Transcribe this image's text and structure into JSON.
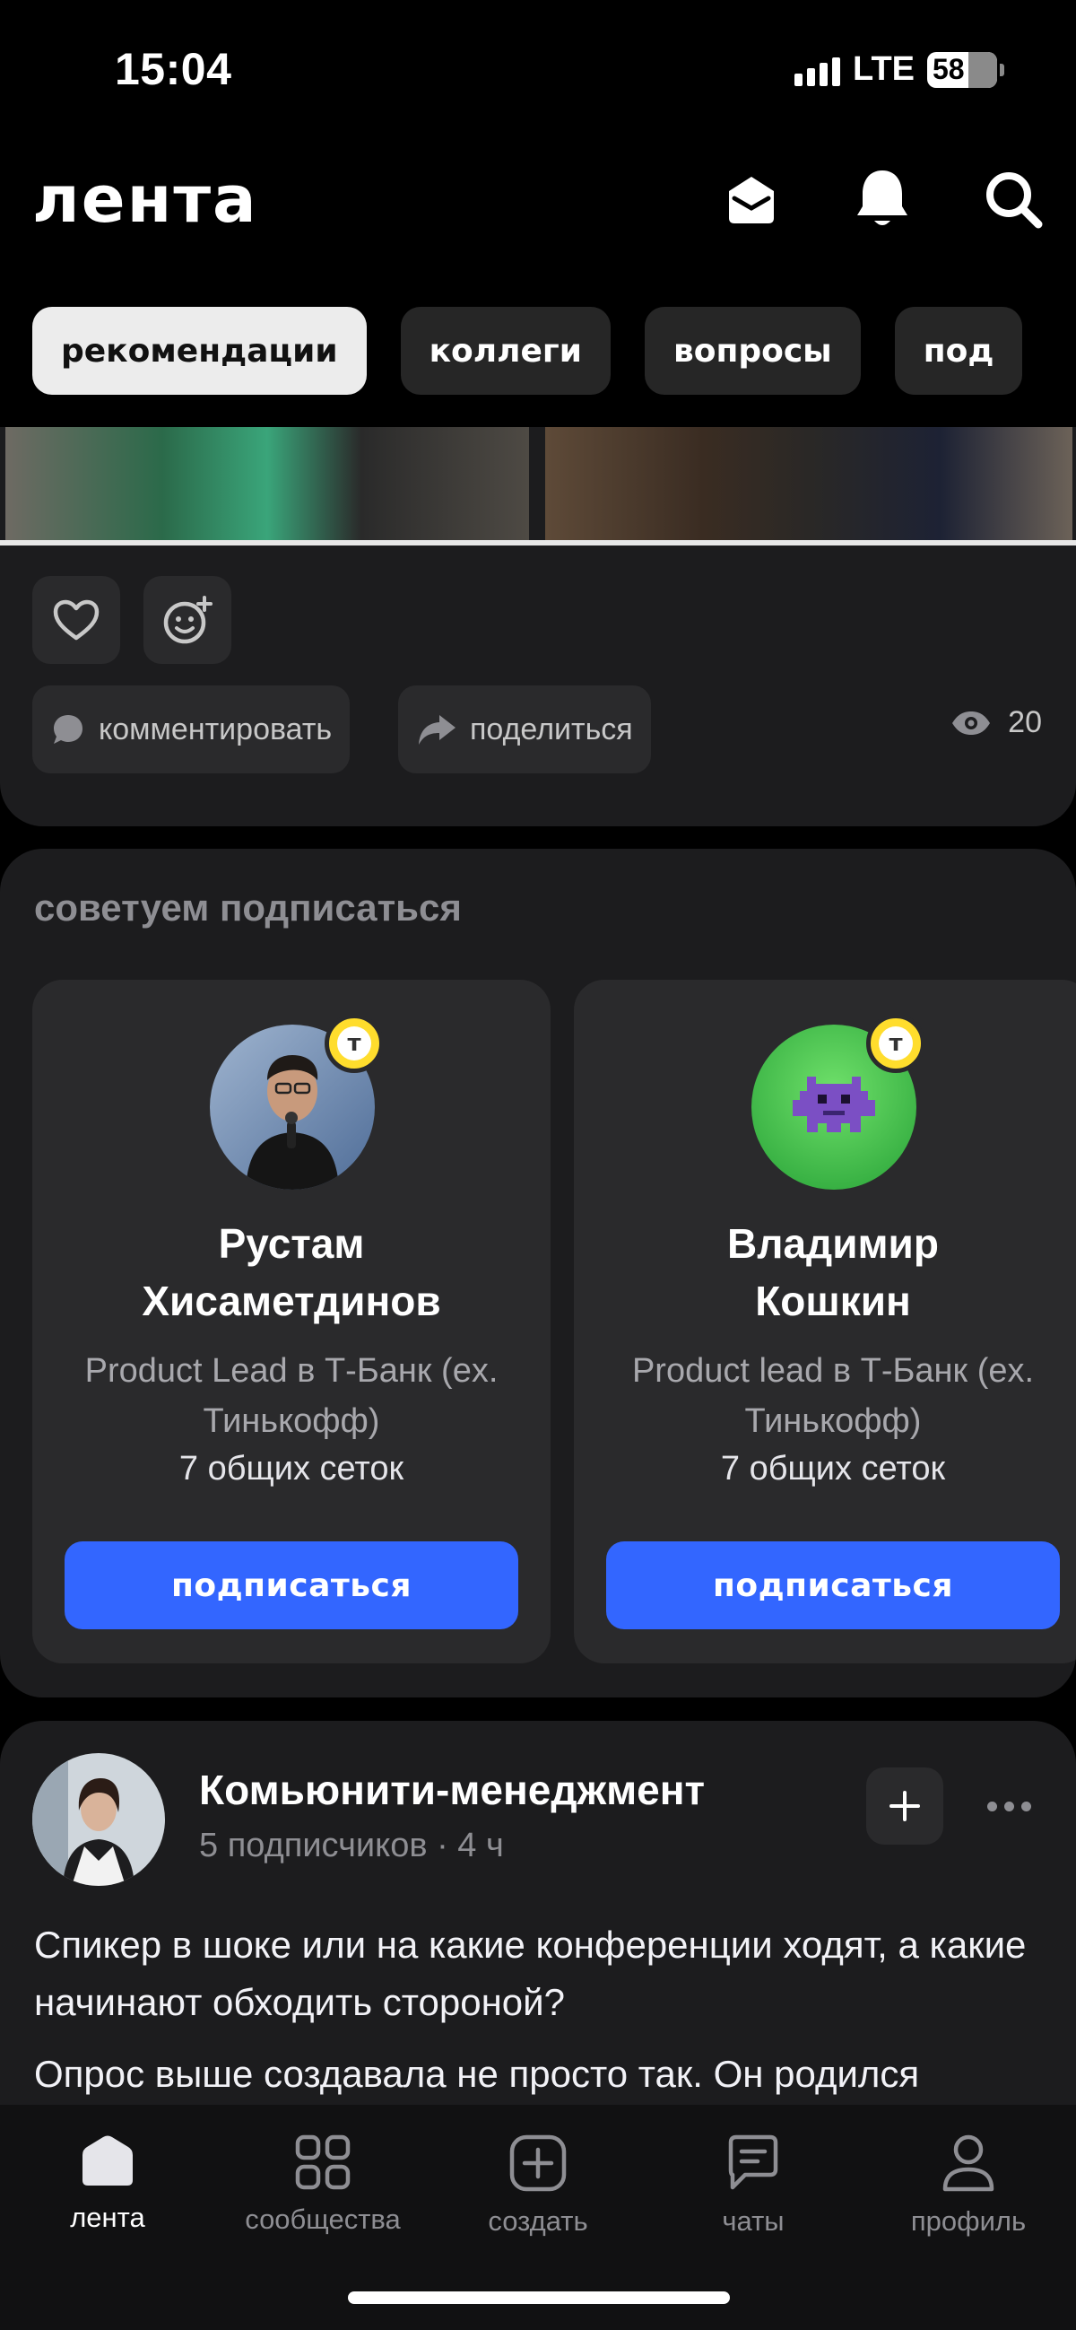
{
  "status_bar": {
    "time": "15:04",
    "network": "LTE",
    "battery": "58"
  },
  "header": {
    "title": "лента"
  },
  "tabs": [
    {
      "label": "рекомендации",
      "active": true
    },
    {
      "label": "коллеги",
      "active": false
    },
    {
      "label": "вопросы",
      "active": false
    },
    {
      "label": "под",
      "active": false
    }
  ],
  "post_actions": {
    "comment_label": "комментировать",
    "share_label": "поделиться",
    "views": "20"
  },
  "suggestions": {
    "title": "советуем подписаться",
    "people": [
      {
        "name_line1": "Рустам",
        "name_line2": "Хисаметдинов",
        "role_line1": "Product Lead в Т-Банк (ex.",
        "role_line2": "Тинькофф)",
        "common": "7 общих сеток",
        "button": "подписаться",
        "badge": "т"
      },
      {
        "name_line1": "Владимир",
        "name_line2": "Кошкин",
        "role_line1": "Product lead в Т-Банк (ex.",
        "role_line2": "Тинькофф)",
        "common": "7 общих сеток",
        "button": "подписаться",
        "badge": "т"
      }
    ]
  },
  "post": {
    "author": "Комьюнити-менеджмент",
    "meta": "5 подписчиков · 4 ч",
    "text": "Спикер в шоке или на какие конференции ходят, а какие начинают обходить стороной?",
    "text_cut": "Опрос выше создавала не просто так. Он родился"
  },
  "bottom_nav": [
    {
      "label": "лента",
      "icon": "home-icon",
      "active": true
    },
    {
      "label": "сообщества",
      "icon": "grid-icon",
      "active": false
    },
    {
      "label": "создать",
      "icon": "plus-square-icon",
      "active": false
    },
    {
      "label": "чаты",
      "icon": "chat-icon",
      "active": false
    },
    {
      "label": "профиль",
      "icon": "profile-icon",
      "active": false
    }
  ],
  "colors": {
    "accent": "#3366ff",
    "background": "#000000",
    "card": "#1c1c1e",
    "badge": "#ffdd2d"
  }
}
